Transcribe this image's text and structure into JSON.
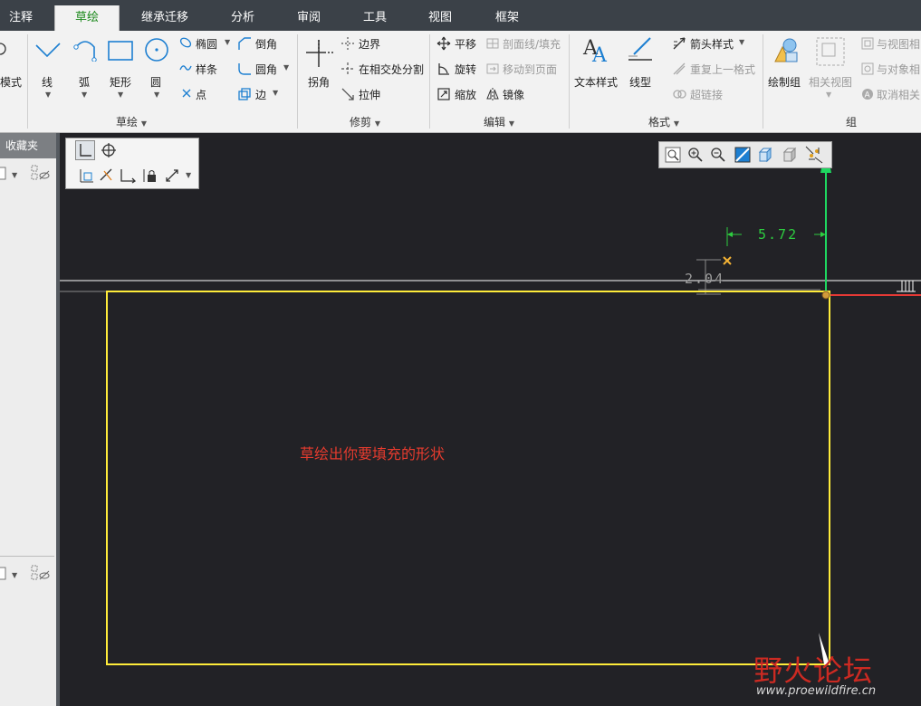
{
  "tabs": [
    {
      "label": "注释",
      "active": false
    },
    {
      "label": "草绘",
      "active": true
    },
    {
      "label": "继承迁移",
      "active": false
    },
    {
      "label": "分析",
      "active": false
    },
    {
      "label": "审阅",
      "active": false
    },
    {
      "label": "工具",
      "active": false
    },
    {
      "label": "视图",
      "active": false
    },
    {
      "label": "框架",
      "active": false
    }
  ],
  "ribbon": {
    "mode_label": "模式",
    "sketch": {
      "line": "线",
      "arc": "弧",
      "rectangle": "矩形",
      "circle": "圆",
      "ellipse": "椭圆",
      "spline": "样条",
      "point": "点",
      "chamfer": "倒角",
      "fillet": "圆角",
      "edge": "边",
      "group_label": "草绘"
    },
    "trim": {
      "corner": "拐角",
      "boundary": "边界",
      "divide_at_intersection": "在相交处分割",
      "stretch": "拉伸",
      "group_label": "修剪"
    },
    "edit": {
      "translate": "平移",
      "rotate": "旋转",
      "scale": "缩放",
      "xhatch": "剖面线/填充",
      "move_to_page": "移动到页面",
      "mirror": "镜像",
      "group_label": "编辑"
    },
    "format": {
      "text_style": "文本样式",
      "line_style": "线型",
      "arrow_style": "箭头样式",
      "repeat_format": "重复上一格式",
      "hyperlink": "超链接",
      "group_label": "格式"
    },
    "group": {
      "draw_group": "绘制组",
      "related_view": "相关视图",
      "relate_to_view": "与视图相",
      "relate_to_object": "与对象相",
      "unrelate": "取消相关",
      "group_label": "组"
    }
  },
  "left_panel": {
    "title": "收藏夹"
  },
  "dimensions": {
    "horizontal": "5.72",
    "vertical": "2.04"
  },
  "annotation": "草绘出你要填充的形状",
  "watermark": {
    "name": "野火论坛",
    "url": "www.proewildfire.cn"
  },
  "colors": {
    "sketch_rect": "#ffec3a",
    "dimension": "#2ecc40",
    "axis_red": "#e53935",
    "axis_green": "#1ed760",
    "annotation": "#e63b2e",
    "canvas": "#222226"
  }
}
